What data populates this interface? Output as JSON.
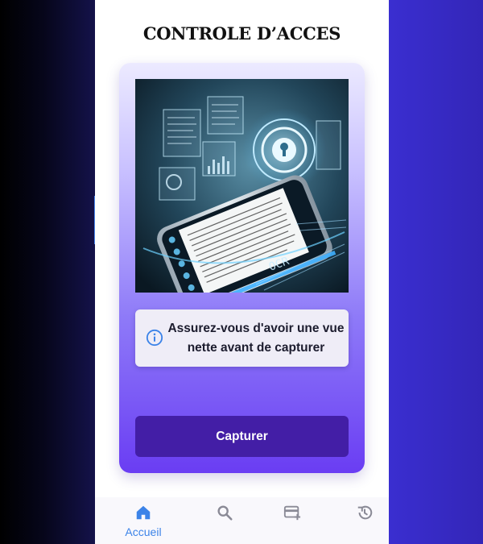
{
  "app": {
    "title": "CONTROLE D’ACCES"
  },
  "hero": {
    "overlay_text": "OCR"
  },
  "info": {
    "icon": "info-icon",
    "message": "Assurez-vous d'avoir une vue nette avant de capturer"
  },
  "actions": {
    "capture_label": "Capturer"
  },
  "bottom_nav": {
    "items": [
      {
        "icon": "home-icon",
        "label": "Accueil",
        "active": true
      },
      {
        "icon": "search-icon",
        "label": "",
        "active": false
      },
      {
        "icon": "card-add-icon",
        "label": "",
        "active": false
      },
      {
        "icon": "history-icon",
        "label": "",
        "active": false
      }
    ]
  },
  "colors": {
    "accent": "#3c83e8",
    "button": "#431ea6",
    "nav_inactive": "#8a8a96"
  }
}
